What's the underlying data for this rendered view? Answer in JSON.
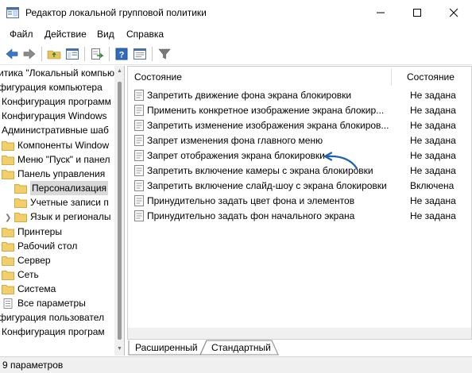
{
  "window": {
    "title": "Редактор локальной групповой политики",
    "minimize_icon": "minimize-icon",
    "maximize_icon": "maximize-icon",
    "close_icon": "close-icon"
  },
  "menu": [
    "Файл",
    "Действие",
    "Вид",
    "Справка"
  ],
  "toolbar": {
    "buttons": [
      "back-arrow-icon",
      "forward-arrow-icon",
      "up-folder-icon",
      "show-hide-tree-icon",
      "export-list-icon",
      "help-icon",
      "properties-icon",
      "filter-icon"
    ]
  },
  "tree": {
    "items": [
      {
        "label": "Политика \"Локальный компьютер\"",
        "display": "итика \"Локальный компью",
        "level": 0,
        "folder": false
      },
      {
        "label": "Конфигурация компьютера",
        "display": "фигурация компьютера",
        "level": 0,
        "folder": false
      },
      {
        "label": "Конфигурация программ",
        "display": "Конфигурация программ",
        "level": 0,
        "folder": false
      },
      {
        "label": "Конфигурация Windows",
        "display": "Конфигурация Windows",
        "level": 0,
        "folder": false
      },
      {
        "label": "Административные шаблоны",
        "display": "Административные шаб",
        "level": 0,
        "folder": false
      },
      {
        "label": "Компоненты Windows",
        "display": "Компоненты Window",
        "level": 1,
        "folder": true
      },
      {
        "label": "Меню \"Пуск\" и панель задач",
        "display": "Меню \"Пуск\" и панел",
        "level": 1,
        "folder": true
      },
      {
        "label": "Панель управления",
        "display": "Панель управления",
        "level": 1,
        "folder": true
      },
      {
        "label": "Персонализация",
        "display": "Персонализация",
        "level": 2,
        "folder": true,
        "selected": true
      },
      {
        "label": "Учетные записи пользователей",
        "display": "Учетные записи п",
        "level": 2,
        "folder": true
      },
      {
        "label": "Язык и региональные стандарты",
        "display": "Язык и регионалы",
        "level": 2,
        "folder": true,
        "expander": true
      },
      {
        "label": "Принтеры",
        "display": "Принтеры",
        "level": 1,
        "folder": true
      },
      {
        "label": "Рабочий стол",
        "display": "Рабочий стол",
        "level": 1,
        "folder": true
      },
      {
        "label": "Сервер",
        "display": "Сервер",
        "level": 1,
        "folder": true
      },
      {
        "label": "Сеть",
        "display": "Сеть",
        "level": 1,
        "folder": true
      },
      {
        "label": "Система",
        "display": "Система",
        "level": 1,
        "folder": true
      },
      {
        "label": "Все параметры",
        "display": "Все параметры",
        "level": 1,
        "folder": false,
        "settings": true
      },
      {
        "label": "Конфигурация пользователя",
        "display": "фигурация пользовател",
        "level": 0,
        "folder": false
      },
      {
        "label": "Конфигурация программ",
        "display": "Конфигурация програм",
        "level": 0,
        "folder": false
      }
    ]
  },
  "list": {
    "columns": [
      "Состояние",
      "Состояние"
    ],
    "rows": [
      {
        "name": "Запретить движение фона экрана блокировки",
        "state": "Не задана"
      },
      {
        "name": "Применить конкретное изображение экрана блокир...",
        "state": "Не задана"
      },
      {
        "name": "Запретить изменение изображения экрана блокиров...",
        "state": "Не задана"
      },
      {
        "name": "Запрет изменения фона главного меню",
        "state": "Не задана"
      },
      {
        "name": "Запрет отображения экрана блокировки",
        "state": "Не задана"
      },
      {
        "name": "Запретить включение камеры с экрана блокировки",
        "state": "Не задана"
      },
      {
        "name": "Запретить включение слайд-шоу с экрана блокировки",
        "state": "Включена"
      },
      {
        "name": "Принудительно задать цвет фона и элементов",
        "state": "Не задана"
      },
      {
        "name": "Принудительно задать фон начального экрана",
        "state": "Не задана"
      }
    ]
  },
  "tabs": [
    "Расширенный",
    "Стандартный"
  ],
  "status": "9 параметров",
  "colors": {
    "annotation_arrow": "#1f5fb4",
    "folder": "#e8c25a",
    "selection": "#d9d9d9"
  }
}
